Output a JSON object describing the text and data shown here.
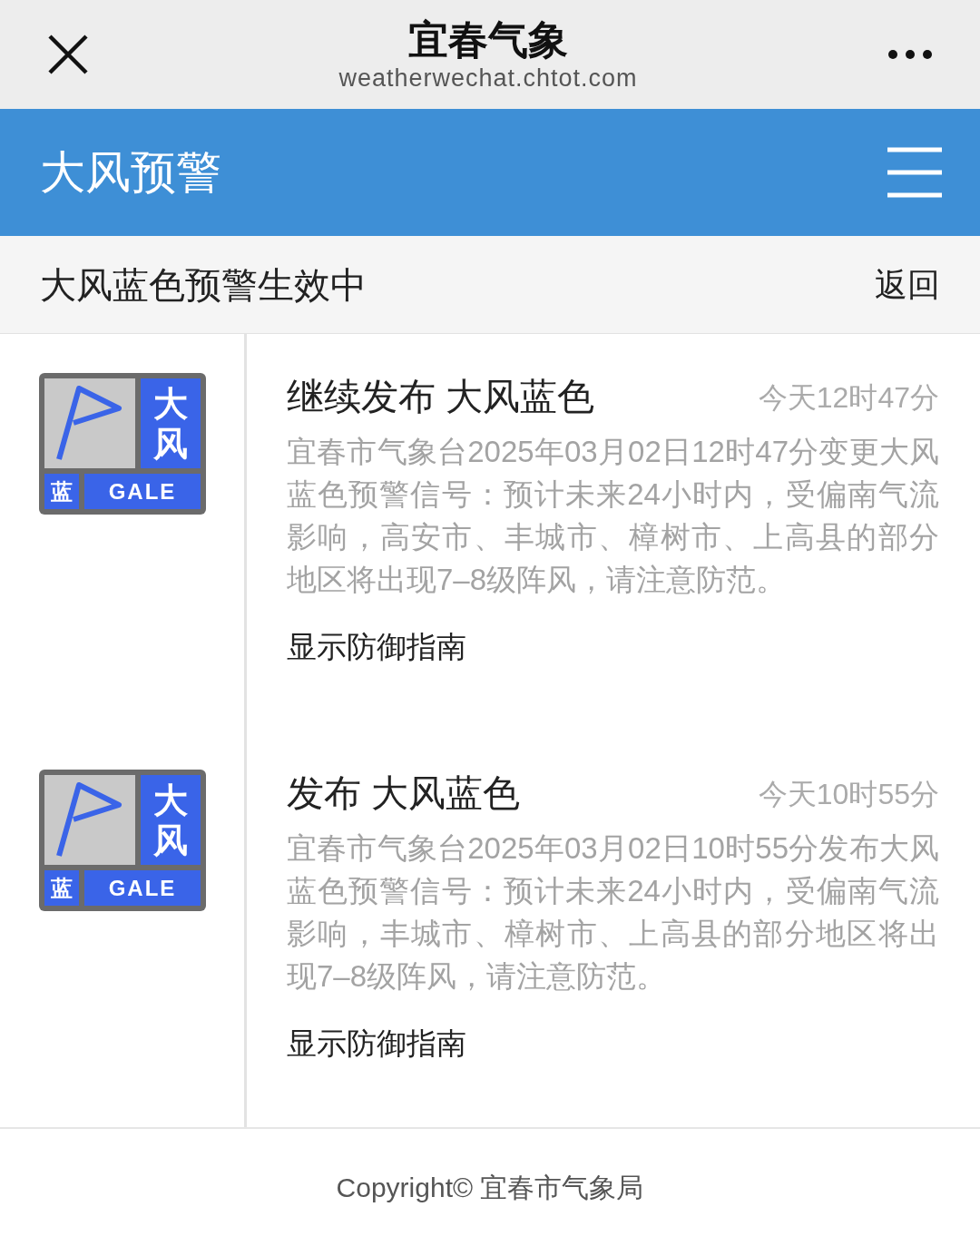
{
  "nav": {
    "title": "宜春气象",
    "subtitle": "weatherwechat.chtot.com"
  },
  "header": {
    "title": "大风预警"
  },
  "status": {
    "text": "大风蓝色预警生效中",
    "back": "返回"
  },
  "warnings": [
    {
      "badge": {
        "chars": [
          "大",
          "风"
        ],
        "level": "蓝",
        "en": "GALE"
      },
      "title": "继续发布 大风蓝色",
      "time": "今天12时47分",
      "body": "宜春市气象台2025年03月02日12时47分变更大风蓝色预警信号：预计未来24小时内，受偏南气流影响，高安市、丰城市、樟树市、上高县的部分地区将出现7–8级阵风，请注意防范。",
      "guide": "显示防御指南"
    },
    {
      "badge": {
        "chars": [
          "大",
          "风"
        ],
        "level": "蓝",
        "en": "GALE"
      },
      "title": "发布 大风蓝色",
      "time": "今天10时55分",
      "body": "宜春市气象台2025年03月02日10时55分发布大风蓝色预警信号：预计未来24小时内，受偏南气流影响，丰城市、樟树市、上高县的部分地区将出现7–8级阵风，请注意防范。",
      "guide": "显示防御指南"
    }
  ],
  "footer": "Copyright© 宜春市气象局"
}
